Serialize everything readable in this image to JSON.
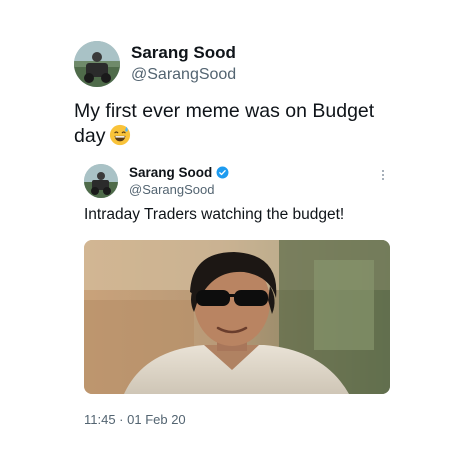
{
  "tweet": {
    "author_name": "Sarang Sood",
    "author_handle": "@SarangSood",
    "text": "My first ever meme was on Budget day",
    "emoji": "grinning-face-with-sweat"
  },
  "quoted_tweet": {
    "author_name": "Sarang Sood",
    "author_handle": "@SarangSood",
    "verified": true,
    "text": "Intraday Traders watching the budget!",
    "media": "photo-man-in-sunglasses",
    "timestamp": "11:45 · 01 Feb 20"
  },
  "colors": {
    "text_primary": "#0f1419",
    "text_secondary": "#536471",
    "verified_blue": "#1d9bf0"
  }
}
